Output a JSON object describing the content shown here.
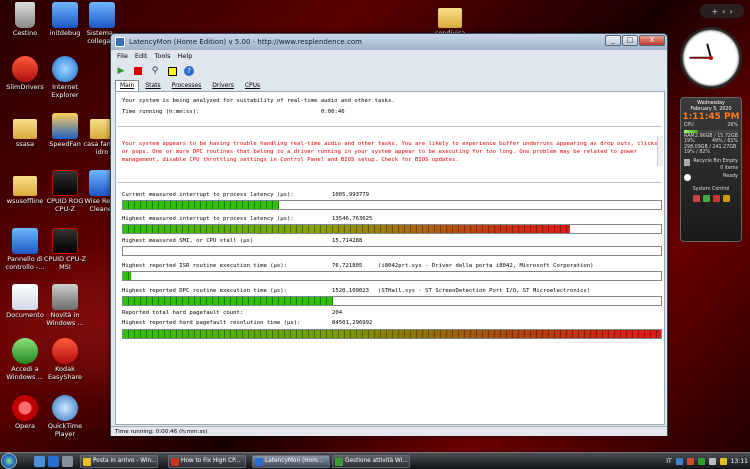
{
  "desktop": {
    "icons": [
      {
        "label": "Cestino"
      },
      {
        "label": "initdebug"
      },
      {
        "label": "Sistema - collegam"
      },
      {
        "label": "condivisa"
      },
      {
        "label": "SlimDrivers"
      },
      {
        "label": "Internet Explorer"
      },
      {
        "label": "ssasa"
      },
      {
        "label": "SpeedFan"
      },
      {
        "label": "casa family idro"
      },
      {
        "label": "wsusoffline"
      },
      {
        "label": "CPUID ROG CPU-Z"
      },
      {
        "label": "Wise Regis Cleaner"
      },
      {
        "label": "Pannello di controllo -..."
      },
      {
        "label": "CPUID CPU-Z MSI"
      },
      {
        "label": "Documento"
      },
      {
        "label": "Novità in Windows ..."
      },
      {
        "label": "Accedi a Windows ..."
      },
      {
        "label": "Kodak EasyShare"
      },
      {
        "label": "Opera"
      },
      {
        "label": "QuickTime Player"
      }
    ]
  },
  "window": {
    "title": "LatencyMon (Home Edition)  v 5.00 - http://www.resplendence.com",
    "buttons": {
      "minimize": "_",
      "maximize": "□",
      "close": "X"
    },
    "menu": [
      "File",
      "Edit",
      "Tools",
      "Help"
    ],
    "tabs": [
      "Main",
      "Stats",
      "Processes",
      "Drivers",
      "CPUs"
    ],
    "active_tab": "Main",
    "analysis_line": "Your system is being analyzed for suitability of real-time audio and other tasks.",
    "time_running_label": "Time running (h:mm:ss):",
    "time_running_value": "0:00:46",
    "warning": "Your system appears to be having trouble handling real-time audio and other tasks. You are likely to experience buffer underruns appearing as drop outs, clicks or pops. One or more DPC routines that belong to a driver running in your system appear to be executing for too long. One problem may be related to power management, disable CPU throttling settings in Control Panel and BIOS setup. Check for BIOS updates.",
    "metrics": [
      {
        "label": "Current measured interrupt to process latency (µs):",
        "value": "1005,993779",
        "extra": "",
        "fill": 0.29,
        "color": "green"
      },
      {
        "label": "Highest measured interrupt to process latency (µs):",
        "value": "13546,763625",
        "extra": "",
        "fill": 0.83,
        "color": "gradient"
      },
      {
        "label": "Highest measured SMI, or CPU stall (µs)",
        "value": "15,714288",
        "extra": "",
        "fill": 0.0,
        "color": "green"
      },
      {
        "label": "Highest reported ISR routine execution time (µs):",
        "value": "76,721805",
        "extra": "(i8042prt.sys - Driver della porta i8042, Microsoft Corporation)",
        "fill": 0.015,
        "color": "green"
      },
      {
        "label": "Highest reported DPC routine execution time (µs):",
        "value": "1520,109023",
        "extra": "(STHall.sys - ST ScreenDetection Port I/O, ST Microelectronics)",
        "fill": 0.39,
        "color": "green"
      }
    ],
    "pagefault_count_label": "Reported total hard pagefault count:",
    "pagefault_count_value": "204",
    "pagefault_time_label": "Highest reported hard pagefault resolution time (µs):",
    "pagefault_time_value": "84501,296992",
    "pagefault_fill": 1.0,
    "status_bar": "Time running: 0:00:46  (h:mm:ss)"
  },
  "gadget": {
    "weekday": "Wednesday",
    "date": "February 5, 2020",
    "time": "1:11:45 PM",
    "cpu_label": "CPU",
    "cpu_value": "26%",
    "cpu_fill": 0.26,
    "ram_label": "RAM",
    "ram_value": "2.96GB / 15.72GB",
    "ram_percent": "19%",
    "drive_c_value": "49% / 61%",
    "drive_d_value": "298.09GB / 241.27GB",
    "drive_pct": "19%  /  82%",
    "recycle_label": "Recycle Bin Empty",
    "recycle_items": "0 items",
    "ready_label": "Ready",
    "system_control": "System Control"
  },
  "taskbar": {
    "tasks": [
      {
        "label": "Posta in arrivo - Win...",
        "active": false
      },
      {
        "label": "How to Fix High CP...",
        "active": false
      },
      {
        "label": "LatencyMon (Hom...",
        "active": true
      },
      {
        "label": "Gestione attività Wi...",
        "active": false
      }
    ],
    "lang": "IT",
    "clock": "13:11"
  },
  "colors": {
    "bar_green": "#2fc000",
    "bar_red": "#e01a1a",
    "warning_text": "#e00000"
  }
}
